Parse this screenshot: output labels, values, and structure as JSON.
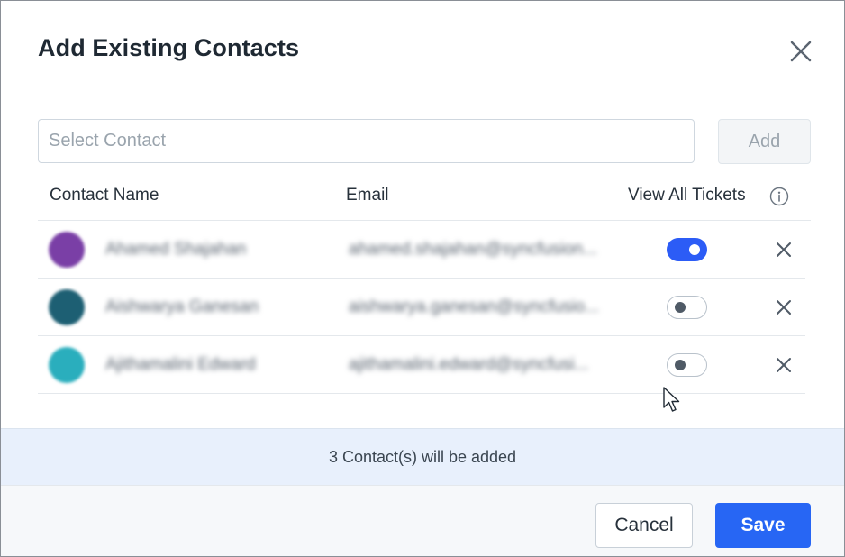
{
  "dialog": {
    "title": "Add Existing Contacts",
    "close_icon": "close-icon"
  },
  "search": {
    "placeholder": "Select Contact",
    "value": "",
    "add_label": "Add"
  },
  "table": {
    "headers": {
      "name": "Contact Name",
      "email": "Email",
      "view_all": "View All Tickets"
    },
    "info_icon": "info-icon",
    "rows": [
      {
        "name": "Ahamed Shajahan",
        "email": "ahamed.shajahan@syncfusion...",
        "avatar_color": "#7a3fa6",
        "view_all_tickets": true
      },
      {
        "name": "Aishwarya Ganesan",
        "email": "aishwarya.ganesan@syncfusio...",
        "avatar_color": "#1d5f73",
        "view_all_tickets": false
      },
      {
        "name": "Ajithamalini Edward",
        "email": "ajithamalini.edward@syncfusi...",
        "avatar_color": "#2aaebd",
        "view_all_tickets": false
      }
    ]
  },
  "summary": {
    "text": "3 Contact(s) will be added"
  },
  "footer": {
    "cancel_label": "Cancel",
    "save_label": "Save"
  },
  "colors": {
    "primary": "#2766f4",
    "toggle_on": "#2c5cf6",
    "summary_bg": "#e8f0fc"
  }
}
